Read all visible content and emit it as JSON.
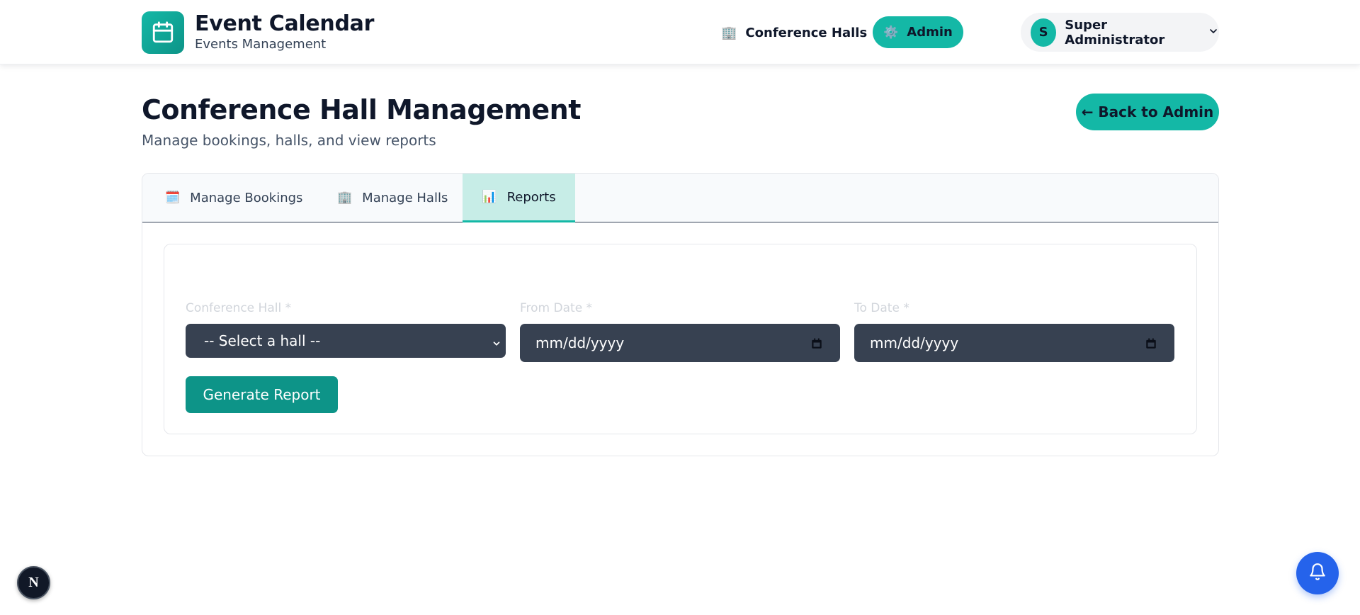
{
  "header": {
    "app_title": "Event Calendar",
    "app_subtitle": "Events Management",
    "nav": {
      "halls_emoji": "🏢",
      "halls_label": "Conference Halls",
      "admin_emoji": "⚙️",
      "admin_label": "Admin"
    },
    "user": {
      "initial": "S",
      "name": "Super Administrator"
    }
  },
  "page": {
    "title": "Conference Hall Management",
    "subtitle": "Manage bookings, halls, and view reports",
    "back_label": "← Back to Admin"
  },
  "tabs": [
    {
      "emoji": "🗓️",
      "label": "Manage Bookings"
    },
    {
      "emoji": "🏢",
      "label": "Manage Halls"
    },
    {
      "emoji": "📊",
      "label": "Reports",
      "active": true
    }
  ],
  "report_form": {
    "hall_label": "Conference Hall *",
    "hall_value": "-- Select a hall --",
    "from_label": "From Date *",
    "from_value": "mm/dd/yyyy",
    "to_label": "To Date *",
    "to_value": "mm/dd/yyyy",
    "generate_label": "Generate Report"
  },
  "floating": {
    "next_badge": "N"
  },
  "colors": {
    "accent": "#14b8a6",
    "accent_dark": "#0d9488",
    "field_bg": "#374151",
    "fab_blue": "#2563eb"
  },
  "icons": {
    "logo": "calendar-icon",
    "user_menu": "chevron-down-icon",
    "select": "chevron-down-icon",
    "date": "calendar-icon",
    "fab": "bell-icon"
  }
}
